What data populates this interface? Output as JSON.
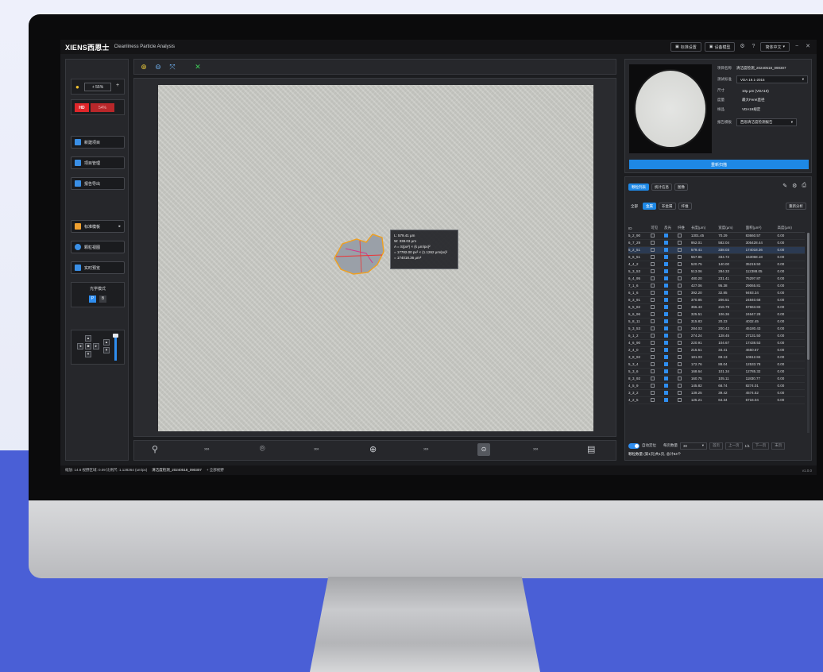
{
  "app": {
    "brand": "XIENS西恩士",
    "title": "Cleanliness Particle Analysis",
    "top_buttons": [
      "标准设置",
      "设备模型"
    ],
    "language": "简体中文"
  },
  "left": {
    "light_value": "+ 55%",
    "hd_label": "HD",
    "hd_value": "54%",
    "actions": [
      "新建项目",
      "项目管理",
      "报告导出"
    ],
    "actions2": [
      "标准模板",
      "颗粒视图",
      "实时预览"
    ],
    "mode_label": "光学模式",
    "mode_p": "P",
    "mode_b": "B"
  },
  "measure": {
    "l": "L: 579.41 μm",
    "w": "W: 338.03 μm",
    "a_formula": "A = S(px²) × (k μm/px)²",
    "a_calc": "= 17782.00 px² × (1.1262 μm/px)²",
    "a_value": "= 174018.36 μm²"
  },
  "info": {
    "project_label": "项目名称",
    "project": "清洁度检测_20240518_090307",
    "standard_label": "测试标准",
    "standard": "VDA 19.1-2015",
    "size_label": "尺寸",
    "size_value": "10μ μm (VDA19)",
    "measure_label": "度量",
    "measure_value": "最大Feret直径",
    "sample_label": "样品",
    "sample_value": "VDA19规定",
    "report_label": "报告模板",
    "report_value": "西恩清洁度检测报告",
    "action_button": "重新扫描"
  },
  "table": {
    "tabs": [
      "颗粒列表",
      "统计信息",
      "图像"
    ],
    "filters": [
      "全部",
      "金属",
      "非金属",
      "纤维"
    ],
    "reset": "重新分析",
    "headers": [
      "ID",
      "可见",
      "反光",
      "纤维",
      "长度(μm)",
      "宽度(μm)",
      "面积(μm²)",
      "高度(μm)"
    ],
    "rows": [
      {
        "id": "5_2_90",
        "len": "1301.45",
        "wid": "70.29",
        "area": "83660.57",
        "h": "0.00",
        "checked": false
      },
      {
        "id": "6_7_29",
        "len": "952.01",
        "wid": "582.04",
        "area": "305428.44",
        "h": "0.00",
        "checked": true
      },
      {
        "id": "5_2_51",
        "len": "579.41",
        "wid": "338.03",
        "area": "174018.36",
        "h": "0.00",
        "checked": true,
        "sel": true
      },
      {
        "id": "6_6_51",
        "len": "557.86",
        "wid": "334.72",
        "area": "153068.18",
        "h": "0.00",
        "checked": false
      },
      {
        "id": "4_4_2",
        "len": "520.75",
        "wid": "140.00",
        "area": "35219.50",
        "h": "0.00",
        "checked": false
      },
      {
        "id": "5_3_53",
        "len": "513.06",
        "wid": "284.33",
        "area": "112388.05",
        "h": "0.00",
        "checked": false
      },
      {
        "id": "6_4_95",
        "len": "480.20",
        "wid": "231.41",
        "area": "75297.87",
        "h": "0.00",
        "checked": false
      },
      {
        "id": "7_1_6",
        "len": "427.06",
        "wid": "95.38",
        "area": "29065.81",
        "h": "0.00",
        "checked": false
      },
      {
        "id": "6_1_6",
        "len": "392.20",
        "wid": "32.85",
        "area": "9493.34",
        "h": "0.00",
        "checked": false
      },
      {
        "id": "8_3_91",
        "len": "370.85",
        "wid": "206.51",
        "area": "24840.68",
        "h": "0.00",
        "checked": false
      },
      {
        "id": "6_5_82",
        "len": "366.43",
        "wid": "216.79",
        "area": "57663.83",
        "h": "0.00",
        "checked": false
      },
      {
        "id": "5_6_96",
        "len": "325.51",
        "wid": "106.36",
        "area": "24647.28",
        "h": "0.00",
        "checked": false
      },
      {
        "id": "5_8_11",
        "len": "315.83",
        "wid": "20.23",
        "area": "4032.45",
        "h": "0.00",
        "checked": false
      },
      {
        "id": "5_3_53",
        "len": "284.03",
        "wid": "200.42",
        "area": "45180.43",
        "h": "0.00",
        "checked": false
      },
      {
        "id": "6_1_2",
        "len": "274.24",
        "wid": "128.45",
        "area": "27131.50",
        "h": "0.00",
        "checked": false
      },
      {
        "id": "4_6_90",
        "len": "220.91",
        "wid": "104.67",
        "area": "17438.53",
        "h": "0.00",
        "checked": false
      },
      {
        "id": "2_4_0",
        "len": "215.51",
        "wid": "34.41",
        "area": "4650.67",
        "h": "0.00",
        "checked": false
      },
      {
        "id": "3_8_92",
        "len": "181.03",
        "wid": "69.13",
        "area": "10612.84",
        "h": "0.00",
        "checked": false
      },
      {
        "id": "5_3_4",
        "len": "172.76",
        "wid": "88.04",
        "area": "12533.78",
        "h": "0.00",
        "checked": false
      },
      {
        "id": "5_3_6",
        "len": "168.64",
        "wid": "101.34",
        "area": "12785.32",
        "h": "0.00",
        "checked": false
      },
      {
        "id": "8_3_92",
        "len": "160.75",
        "wid": "105.11",
        "area": "11830.77",
        "h": "0.00",
        "checked": false
      },
      {
        "id": "4_5_9",
        "len": "145.82",
        "wid": "68.74",
        "area": "8274.01",
        "h": "0.00",
        "checked": false
      },
      {
        "id": "3_3_2",
        "len": "139.25",
        "wid": "39.42",
        "area": "4574.52",
        "h": "0.00",
        "checked": false
      },
      {
        "id": "4_2_5",
        "len": "125.21",
        "wid": "64.34",
        "area": "6716.04",
        "h": "0.00",
        "checked": false
      }
    ],
    "auto_label": "自动定位",
    "per_page_label": "每页数量",
    "per_page": "30",
    "page_first": "首页",
    "page_prev": "上一页",
    "page_info": "1/1",
    "page_next": "下一页",
    "page_last": "末页",
    "summary": "颗粒数量 (第1页)共1页, 总计84个"
  },
  "status": {
    "text": "缩放: 14.8  视野区域: 0.09  比例尺: 1.128264 (um/px)",
    "path": "清洁度检测_20240518_090307",
    "extra": "+ 全部视野",
    "version": "v1.0.0"
  }
}
